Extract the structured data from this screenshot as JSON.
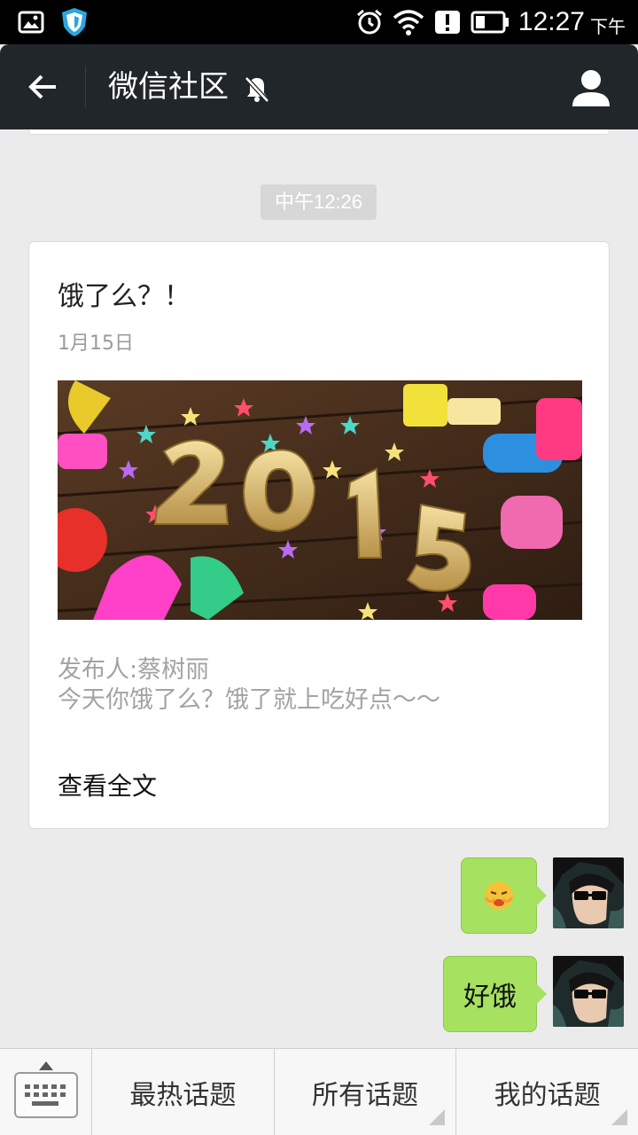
{
  "status_bar": {
    "time": "12:27",
    "ampm": "下午"
  },
  "app_bar": {
    "title": "微信社区"
  },
  "chat": {
    "timestamp": "中午12:26",
    "article": {
      "title": "饿了么？！",
      "date": "1月15日",
      "image_text": "2015",
      "author": "发布人:蔡树丽",
      "description": "今天你饿了么？饿了就上吃好点～～",
      "read_more": "查看全文"
    },
    "messages": [
      {
        "text": ""
      },
      {
        "text": "好饿"
      }
    ]
  },
  "bottom_bar": {
    "tabs": [
      {
        "label": "最热话题"
      },
      {
        "label": "所有话题"
      },
      {
        "label": "我的话题"
      }
    ]
  },
  "colors": {
    "app_bar": "#21262b",
    "bubble": "#a6e160",
    "background": "#ebebeb"
  }
}
